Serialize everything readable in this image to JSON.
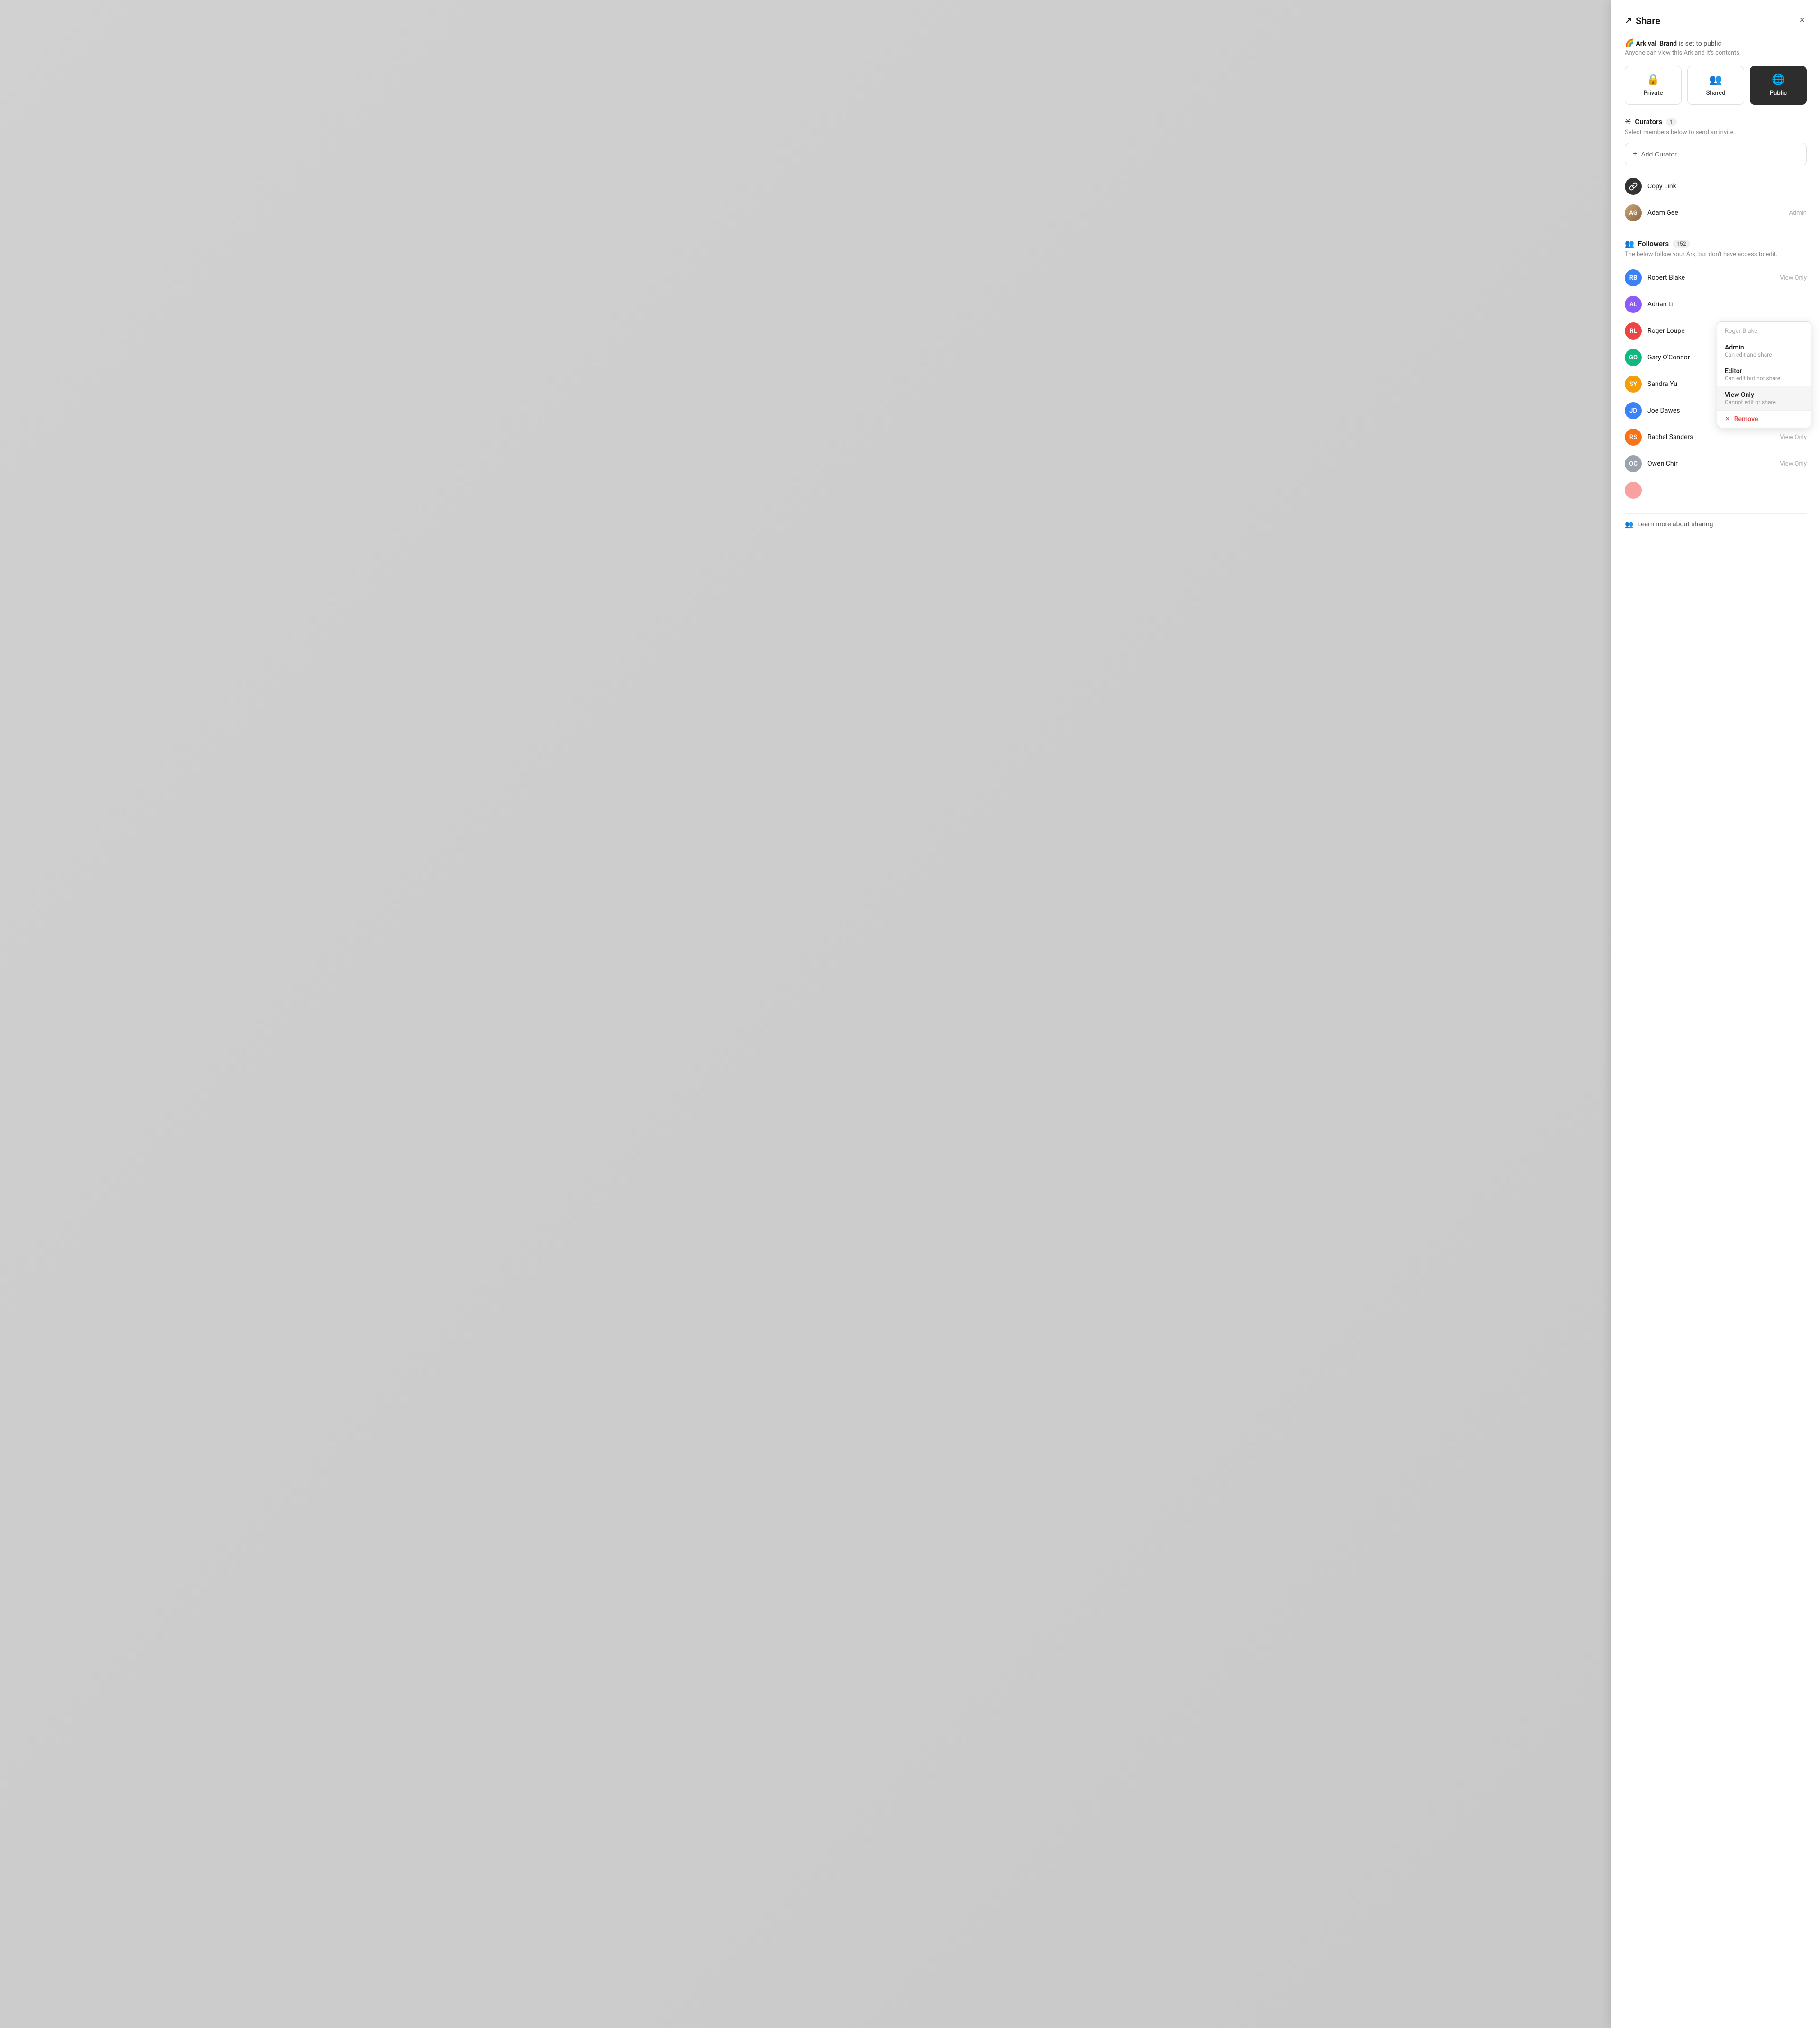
{
  "panel": {
    "title": "Share",
    "close_label": "×",
    "ark_name": "Arkival_Brand",
    "ark_status_text": "is set to",
    "ark_visibility": "public",
    "ark_desc": "Anyone can view this Ark and it's contents.",
    "visibility_options": [
      {
        "id": "private",
        "label": "Private",
        "icon": "🔒",
        "active": false
      },
      {
        "id": "shared",
        "label": "Shared",
        "icon": "👥",
        "active": false
      },
      {
        "id": "public",
        "label": "Public",
        "icon": "🌐",
        "active": true
      }
    ],
    "curators_section": {
      "title": "Curators",
      "badge": "1",
      "desc": "Select members below to send an invite.",
      "add_button_label": "Add Curator",
      "copy_link_label": "Copy Link",
      "curators": [
        {
          "name": "Adam Gee",
          "role": "Admin",
          "initials": "AG",
          "color": "#8b6340",
          "is_image": true
        }
      ]
    },
    "followers_section": {
      "title": "Followers",
      "badge": "152",
      "desc": "The below follow your Ark, but don't have access to edit.",
      "followers": [
        {
          "name": "Robert Blake",
          "role": "View Only",
          "initials": "RB",
          "color": "#3b82f6",
          "show_dropdown": false
        },
        {
          "name": "Adrian Li",
          "role": "",
          "initials": "AL",
          "color": "#8b5cf6",
          "show_dropdown": false
        },
        {
          "name": "Roger Loupe",
          "role": "",
          "initials": "RL",
          "color": "#ef4444",
          "show_dropdown": true
        },
        {
          "name": "Gary O'Connor",
          "role": "",
          "initials": "GO",
          "color": "#10b981",
          "show_dropdown": false
        },
        {
          "name": "Sandra Yu",
          "role": "",
          "initials": "SY",
          "color": "#f59e0b",
          "show_dropdown": false
        },
        {
          "name": "Joe Dawes",
          "role": "",
          "initials": "JD",
          "color": "#3b82f6",
          "show_dropdown": false
        },
        {
          "name": "Rachel Sanders",
          "role": "View Only",
          "initials": "RS",
          "color": "#f97316",
          "show_dropdown": false
        },
        {
          "name": "Owen Chir",
          "role": "View Only",
          "initials": "OC",
          "color": "#9ca3af",
          "show_dropdown": false
        }
      ]
    },
    "dropdown": {
      "header_name": "Roger Blake",
      "options": [
        {
          "title": "Admin",
          "desc": "Can edit and share",
          "selected": false
        },
        {
          "title": "Editor",
          "desc": "Can edit but not share",
          "selected": false
        },
        {
          "title": "View Only",
          "desc": "Cannot edit or share",
          "selected": true
        }
      ],
      "remove_label": "Remove"
    },
    "learn_more_label": "Learn more about sharing"
  }
}
